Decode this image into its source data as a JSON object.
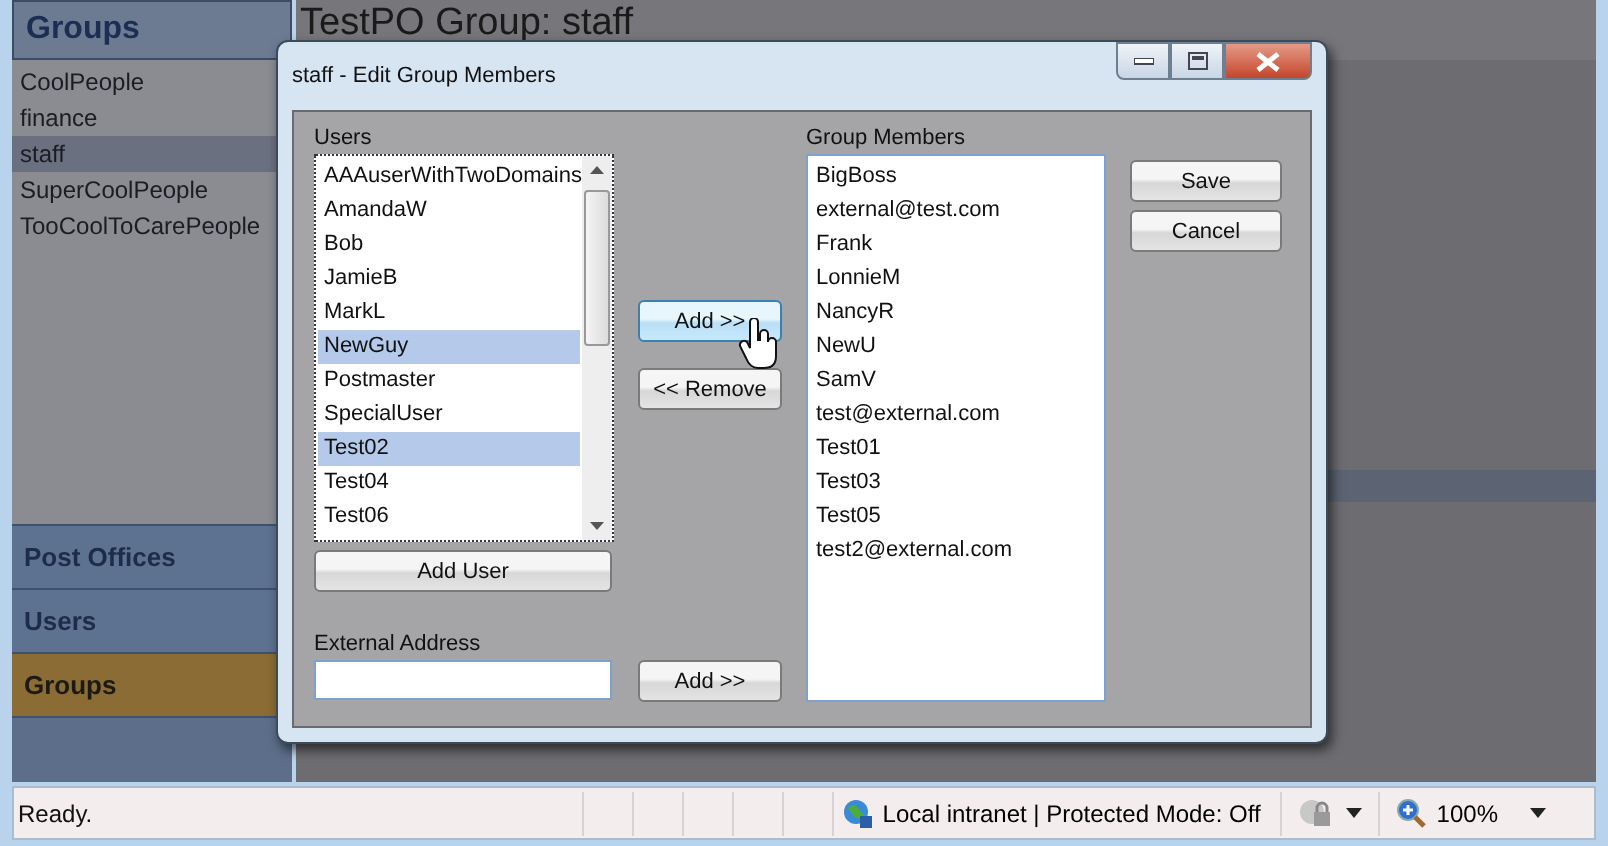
{
  "sidebar": {
    "title": "Groups",
    "items": [
      {
        "label": "CoolPeople",
        "selected": false
      },
      {
        "label": "finance",
        "selected": false
      },
      {
        "label": "staff",
        "selected": true
      },
      {
        "label": "SuperCoolPeople",
        "selected": false
      },
      {
        "label": "TooCoolToCarePeople",
        "selected": false
      }
    ],
    "nav": [
      {
        "label": "Post Offices",
        "selected": false
      },
      {
        "label": "Users",
        "selected": false
      },
      {
        "label": "Groups",
        "selected": true
      }
    ]
  },
  "main": {
    "title": "TestPO Group: staff"
  },
  "dialog": {
    "title": "staff - Edit Group Members",
    "users_label": "Users",
    "users": [
      {
        "name": "AAAuserWithTwoDomains",
        "selected": false
      },
      {
        "name": "AmandaW",
        "selected": false
      },
      {
        "name": "Bob",
        "selected": false
      },
      {
        "name": "JamieB",
        "selected": false
      },
      {
        "name": "MarkL",
        "selected": false
      },
      {
        "name": "NewGuy",
        "selected": true
      },
      {
        "name": "Postmaster",
        "selected": false
      },
      {
        "name": "SpecialUser",
        "selected": false
      },
      {
        "name": "Test02",
        "selected": true
      },
      {
        "name": "Test04",
        "selected": false
      },
      {
        "name": "Test06",
        "selected": false
      }
    ],
    "add_user": "Add User",
    "add_button": {
      "label": "Add >>",
      "hovered": true
    },
    "remove_button": {
      "label": "<< Remove",
      "hovered": false
    },
    "members_label": "Group Members",
    "members": [
      "BigBoss",
      "external@test.com",
      "Frank",
      "LonnieM",
      "NancyR",
      "NewU",
      "SamV",
      "test@external.com",
      "Test01",
      "Test03",
      "Test05",
      "test2@external.com"
    ],
    "save": "Save",
    "cancel": "Cancel",
    "external_label": "External Address",
    "external_add": {
      "label": "Add >>",
      "hovered": false
    }
  },
  "status_bar": {
    "text": "Ready.",
    "zone": "Local intranet | Protected Mode: Off",
    "zoom": "100%"
  }
}
